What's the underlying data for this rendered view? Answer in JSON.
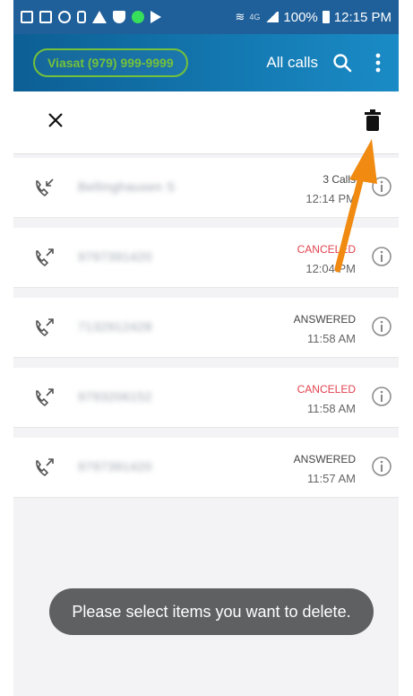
{
  "status_bar": {
    "battery": "100%",
    "time": "12:15 PM",
    "network": "4G"
  },
  "app_bar": {
    "account": "Viasat (979) 999-9999",
    "filter": "All calls"
  },
  "toast": "Please select items you want to delete.",
  "calls": [
    {
      "direction": "incoming",
      "number": "Bellinghausen S",
      "status": "3 Calls",
      "time": "12:14 PM",
      "status_color": "#444444"
    },
    {
      "direction": "outgoing",
      "number": "9797391420",
      "status": "CANCELED",
      "time": "12:04 PM",
      "status_color": "#e1424e"
    },
    {
      "direction": "outgoing",
      "number": "7132912428",
      "status": "ANSWERED",
      "time": "11:58 AM",
      "status_color": "#444444"
    },
    {
      "direction": "outgoing",
      "number": "9793206152",
      "status": "CANCELED",
      "time": "11:58 AM",
      "status_color": "#e1424e"
    },
    {
      "direction": "outgoing",
      "number": "9797391420",
      "status": "ANSWERED",
      "time": "11:57 AM",
      "status_color": "#444444"
    }
  ],
  "colors": {
    "status_bar": "#1f5f9a",
    "app_bar_start": "#0c5f94",
    "app_bar_end": "#1a8bc6",
    "accent_green": "#74c13b",
    "canceled": "#e1424e",
    "annotation_arrow": "#f08a10"
  },
  "icons": {
    "close": "close-icon",
    "delete": "trash-icon",
    "search": "search-icon",
    "menu": "more-vert-icon",
    "info": "info-icon",
    "incoming": "incoming-call-icon",
    "outgoing": "outgoing-call-icon"
  }
}
